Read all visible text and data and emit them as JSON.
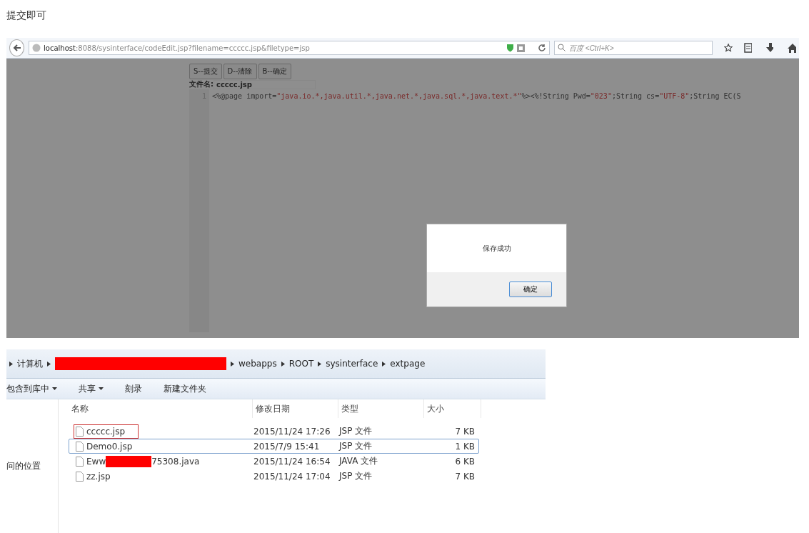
{
  "caption": "提交即可",
  "browser": {
    "url_host": "localhost",
    "url_rest": ":8088/sysinterface/codeEdit.jsp?filename=ccccc.jsp&filetype=jsp",
    "search_placeholder": "百度 <Ctrl+K>",
    "editor": {
      "buttons": [
        "S--提交",
        "D--清除",
        "B--确定"
      ],
      "filename_label": "文件名:",
      "filename": "ccccc.jsp",
      "line_number": "1",
      "code": [
        {
          "kind": "plain",
          "text": "<%@page import="
        },
        {
          "kind": "string",
          "text": "\"java.io.*,java.util.*,java.net.*,java.sql.*,java.text.*\""
        },
        {
          "kind": "plain",
          "text": "%><%!String Pwd="
        },
        {
          "kind": "string",
          "text": "\"023\""
        },
        {
          "kind": "plain",
          "text": ";String cs="
        },
        {
          "kind": "string",
          "text": "\"UTF-8\""
        },
        {
          "kind": "plain",
          "text": ";String EC(S"
        }
      ]
    },
    "dialog": {
      "message": "保存成功",
      "button": "确定"
    }
  },
  "explorer": {
    "breadcrumb": [
      {
        "kind": "text",
        "text": "计算机"
      },
      {
        "kind": "redacted"
      },
      {
        "kind": "text",
        "text": "webapps"
      },
      {
        "kind": "text",
        "text": "ROOT"
      },
      {
        "kind": "text",
        "text": "sysinterface"
      },
      {
        "kind": "text",
        "text": "extpage"
      }
    ],
    "toolbar": [
      {
        "label": "包含到库中",
        "dropdown": true
      },
      {
        "label": "共享",
        "dropdown": true
      },
      {
        "label": "刻录",
        "dropdown": false
      },
      {
        "label": "新建文件夹",
        "dropdown": false
      }
    ],
    "nav_item": "问的位置",
    "columns": [
      "名称",
      "修改日期",
      "类型",
      "大小"
    ],
    "files": [
      {
        "name_parts": [
          {
            "kind": "text",
            "text": "ccccc.jsp"
          }
        ],
        "date": "2015/11/24 17:26",
        "type": "JSP 文件",
        "size": "7 KB",
        "highlighted": true,
        "selected": false
      },
      {
        "name_parts": [
          {
            "kind": "text",
            "text": "Demo0.jsp"
          }
        ],
        "date": "2015/7/9 15:41",
        "type": "JSP 文件",
        "size": "1 KB",
        "highlighted": false,
        "selected": true
      },
      {
        "name_parts": [
          {
            "kind": "text",
            "text": "Eww"
          },
          {
            "kind": "redacted"
          },
          {
            "kind": "text",
            "text": "75308.java"
          }
        ],
        "date": "2015/11/24 16:54",
        "type": "JAVA 文件",
        "size": "6 KB",
        "highlighted": false,
        "selected": false
      },
      {
        "name_parts": [
          {
            "kind": "text",
            "text": "zz.jsp"
          }
        ],
        "date": "2015/11/24 17:04",
        "type": "JSP 文件",
        "size": "7 KB",
        "highlighted": false,
        "selected": false
      }
    ]
  }
}
